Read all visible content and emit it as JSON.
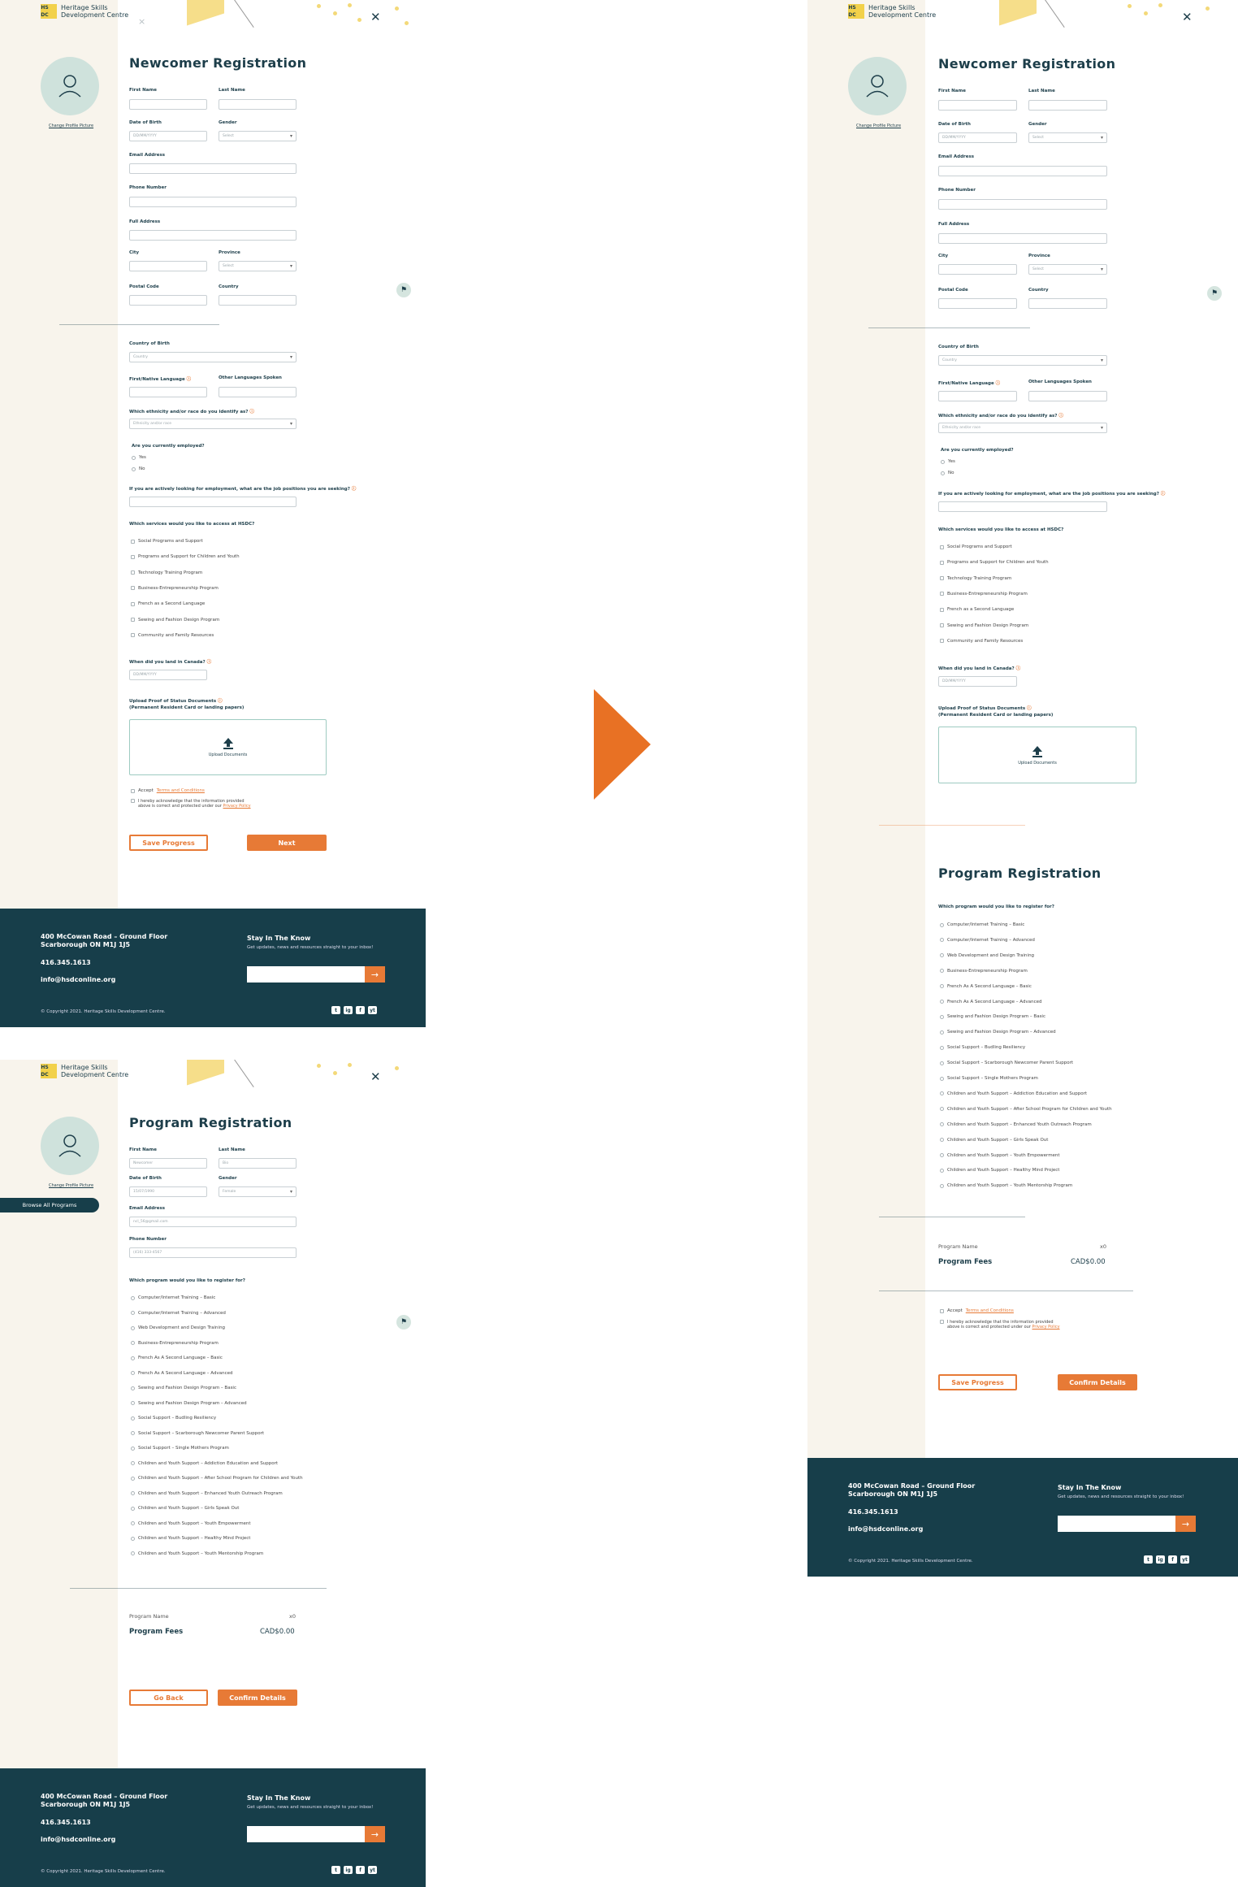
{
  "brand": {
    "logo_mark": [
      "HS",
      "DC"
    ],
    "name_line1": "Heritage Skills",
    "name_line2": "Development Centre"
  },
  "newcomer": {
    "title": "Newcomer Registration",
    "change_photo": "Change Profile Picture",
    "first_name": "First Name",
    "last_name": "Last Name",
    "dob": "Date of Birth",
    "dob_placeholder": "DD/MM/YYYY",
    "gender": "Gender",
    "select": "Select",
    "email": "Email Address",
    "phone": "Phone Number",
    "address": "Full Address",
    "city": "City",
    "province": "Province",
    "postal": "Postal Code",
    "country": "Country",
    "country_birth": "Country of Birth",
    "country_placeholder": "Country",
    "native_lang": "First/Native Language",
    "other_lang": "Other Languages Spoken",
    "ethnicity": "Which ethnicity and/or race do you identify as?",
    "ethnicity_placeholder": "Ethnicity and/or race",
    "employed": "Are you currently employed?",
    "yes": "Yes",
    "no": "No",
    "job_q": "If you are actively looking for employment, what are the job positions you are seeking?",
    "services_q": "Which services would you like to access at HSDC?",
    "services": [
      "Social Programs and Support",
      "Programs and Support for Children and Youth",
      "Technology Training Program",
      "Business-Entrepreneurship Program",
      "French as a Second Language",
      "Sewing and Fashion Design Program",
      "Community and Family Resources"
    ],
    "land_q": "When did you land in Canada?",
    "upload_q1": "Upload Proof of Status Documents",
    "upload_q2": "(Permanent Resident Card or landing papers)",
    "upload_label": "Upload Documents",
    "accept": "Accept",
    "terms": "Terms and Conditions",
    "ack1": "I hereby acknowledge that the information provided",
    "ack2": "above is correct and protected under our",
    "privacy": "Privacy Policy",
    "save": "Save Progress",
    "next": "Next"
  },
  "program": {
    "title": "Program Registration",
    "browse": "Browse All Programs",
    "first_value": "Newcomer",
    "last_value": "Bio",
    "dob_value": "15/07/1990",
    "gender_value": "Female",
    "email_value": "ncl_56@gmail.com",
    "phone_value": "(416) 333-4567",
    "question": "Which program would you like to register for?",
    "programs": [
      "Computer/Internet Training – Basic",
      "Computer/Internet Training – Advanced",
      "Web Development and Design Training",
      "Business-Entrepreneurship Program",
      "French As A Second Language – Basic",
      "French As A Second Language – Advanced",
      "Sewing and Fashion Design Program – Basic",
      "Sewing and Fashion Design Program – Advanced",
      "Social Support – Budling Resiliency",
      "Social Support – Scarborough Newcomer Parent Support",
      "Social Support – Single Mothers Program",
      "Children and Youth Support – Addiction Education and Support",
      "Children and Youth Support – After School Program for Children and Youth",
      "Children and Youth Support – Enhanced Youth Outreach Program",
      "Children and Youth Support – Girls Speak Out",
      "Children and Youth Support – Youth Empowerment",
      "Children and Youth Support – Healthy Mind Project",
      "Children and Youth Support – Youth Mentorship Program"
    ],
    "program_name": "Program Name",
    "program_count": "x0",
    "fees_label": "Program Fees",
    "fees_value": "CAD$0.00",
    "go_back": "Go Back",
    "confirm": "Confirm Details",
    "save": "Save Progress"
  },
  "footer": {
    "addr1": "400 McCowan Road – Ground Floor",
    "addr2": "Scarborough ON M1J 1J5",
    "phone": "416.345.1613",
    "email": "info@hsdconline.org",
    "copyright": "© Copyright 2021. Heritage Skills Development Centre.",
    "stay_head": "Stay In The Know",
    "stay_sub": "Get updates, news and resources straight to your inbox!",
    "social": [
      "t",
      "ig",
      "f",
      "yt"
    ]
  },
  "colors": {
    "accent": "#e77a36",
    "dark": "#173e4a",
    "avatar": "#cfe2dc",
    "side": "#f8f4ec"
  }
}
